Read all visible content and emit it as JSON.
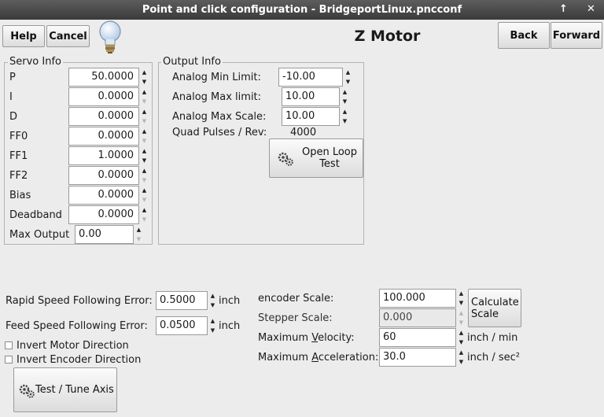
{
  "window": {
    "title": "Point and click configuration - BridgeportLinux.pncconf",
    "up_icon": "↑",
    "close_icon": "✕"
  },
  "toolbar": {
    "help_label": "Help",
    "cancel_label": "Cancel",
    "heading": "Z Motor",
    "back_label": "Back",
    "forward_label": "Forward"
  },
  "servo": {
    "legend": "Servo Info",
    "rows": [
      {
        "label": "P",
        "value": "50.0000"
      },
      {
        "label": "I",
        "value": "0.0000"
      },
      {
        "label": "D",
        "value": "0.0000"
      },
      {
        "label": "FF0",
        "value": "0.0000"
      },
      {
        "label": "FF1",
        "value": "1.0000"
      },
      {
        "label": "FF2",
        "value": "0.0000"
      },
      {
        "label": "Bias",
        "value": "0.0000"
      },
      {
        "label": "Deadband",
        "value": "0.0000"
      }
    ],
    "max_output_label": "Max Output",
    "max_output_value": "0.00"
  },
  "output": {
    "legend": "Output Info",
    "min_limit_label": "Analog Min Limit:",
    "min_limit_value": "-10.00",
    "max_limit_label": "Analog Max limit:",
    "max_limit_value": "10.00",
    "max_scale_label": "Analog Max Scale:",
    "max_scale_value": "10.00",
    "quad_label": "Quad Pulses / Rev:",
    "quad_value": "4000",
    "open_loop_label_1": "Open Loop",
    "open_loop_label_2": "Test"
  },
  "errors": {
    "rapid_label": "Rapid Speed Following Error:",
    "rapid_value": "0.5000",
    "feed_label": "Feed Speed Following Error:",
    "feed_value": "0.0500",
    "unit": "inch"
  },
  "options": {
    "invert_motor": "Invert Motor Direction",
    "invert_encoder": "Invert Encoder Direction",
    "test_tune_label": "Test / Tune Axis"
  },
  "scale": {
    "encoder_label": "encoder Scale:",
    "encoder_value": "100.000",
    "stepper_label": "Stepper Scale:",
    "stepper_value": "0.000",
    "calc_label_1": "Calculate",
    "calc_label_2": "Scale",
    "velocity_pre": "Maximum ",
    "velocity_ul": "V",
    "velocity_post": "elocity:",
    "velocity_value": "60",
    "velocity_unit": "inch / min",
    "accel_pre": "Maximum ",
    "accel_ul": "A",
    "accel_post": "cceleration:",
    "accel_value": "30.0",
    "accel_unit": "inch / sec²"
  }
}
